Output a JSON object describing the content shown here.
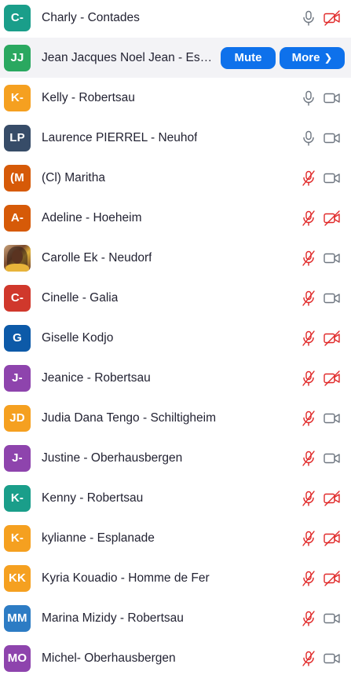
{
  "colors": {
    "muted_red": "#e02828",
    "icon_gray": "#6e7680",
    "accent_blue": "#0e71eb"
  },
  "participants": [
    {
      "initials": "C-",
      "avatar_color": "#1a9e8a",
      "name": "Charly - Contades",
      "mic": "on",
      "video": "off"
    },
    {
      "initials": "JJ",
      "avatar_color": "#2aa860",
      "name": "Jean Jacques Noel Jean - Esplanade",
      "hover": true,
      "mute_label": "Mute",
      "more_label": "More"
    },
    {
      "initials": "K-",
      "avatar_color": "#f5a020",
      "name": "Kelly - Robertsau",
      "mic": "on",
      "video": "on"
    },
    {
      "initials": "LP",
      "avatar_color": "#374c68",
      "name": "Laurence PIERREL - Neuhof",
      "mic": "on",
      "video": "on"
    },
    {
      "initials": "(M",
      "avatar_color": "#d65a08",
      "name": "(Cl) Maritha",
      "mic": "off",
      "video": "on"
    },
    {
      "initials": "A-",
      "avatar_color": "#d65a08",
      "name": "Adeline - Hoeheim",
      "mic": "off",
      "video": "off"
    },
    {
      "initials": "",
      "avatar_color": "#b07a4a",
      "photo": true,
      "name": "Carolle Ek - Neudorf",
      "mic": "off",
      "video": "on"
    },
    {
      "initials": "C-",
      "avatar_color": "#d0382c",
      "name": "Cinelle - Galia",
      "mic": "off",
      "video": "on"
    },
    {
      "initials": "G",
      "avatar_color": "#0d5aa8",
      "name": "Giselle Kodjo",
      "mic": "off",
      "video": "off"
    },
    {
      "initials": "J-",
      "avatar_color": "#8e44ad",
      "name": "Jeanice - Robertsau",
      "mic": "off",
      "video": "off"
    },
    {
      "initials": "JD",
      "avatar_color": "#f5a020",
      "name": "Judia Dana Tengo - Schiltigheim",
      "mic": "off",
      "video": "on"
    },
    {
      "initials": "J-",
      "avatar_color": "#8e44ad",
      "name": "Justine - Oberhausbergen",
      "mic": "off",
      "video": "on"
    },
    {
      "initials": "K-",
      "avatar_color": "#1a9e8a",
      "name": "Kenny - Robertsau",
      "mic": "off",
      "video": "off"
    },
    {
      "initials": "K-",
      "avatar_color": "#f5a020",
      "name": "kylianne - Esplanade",
      "mic": "off",
      "video": "off"
    },
    {
      "initials": "KK",
      "avatar_color": "#f5a020",
      "name": "Kyria Kouadio - Homme de Fer",
      "mic": "off",
      "video": "off"
    },
    {
      "initials": "MM",
      "avatar_color": "#2d7cc4",
      "name": "Marina Mizidy - Robertsau",
      "mic": "off",
      "video": "on"
    },
    {
      "initials": "MO",
      "avatar_color": "#8e44ad",
      "name": "Michel- Oberhausbergen",
      "mic": "off",
      "video": "on"
    }
  ]
}
